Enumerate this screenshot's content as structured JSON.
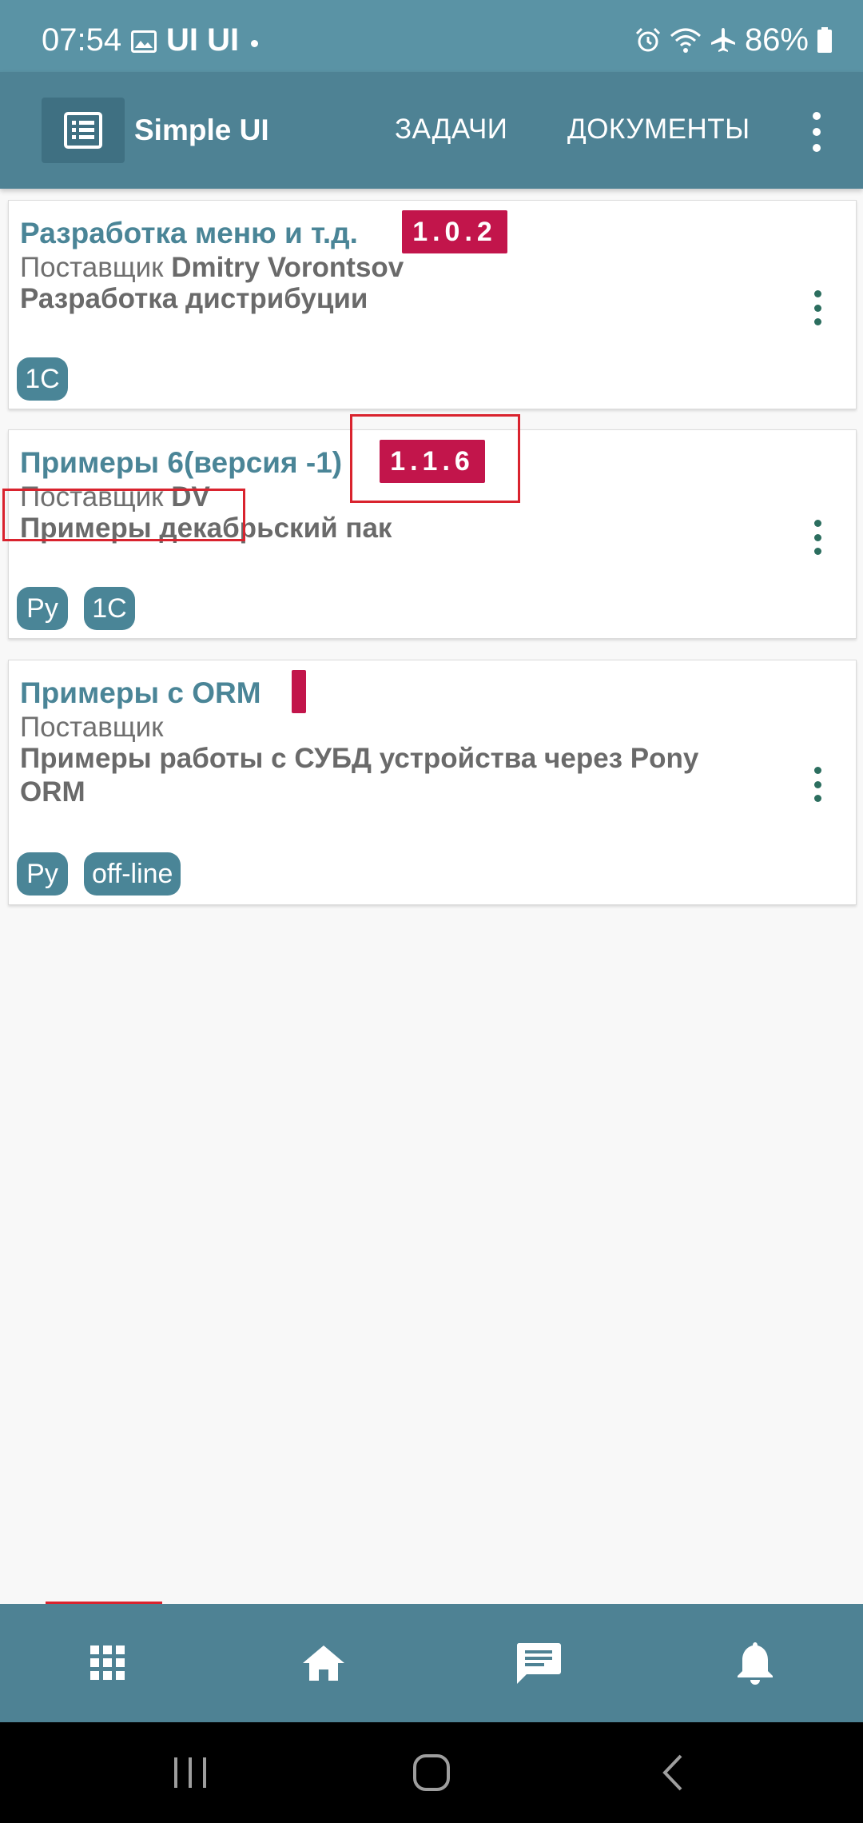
{
  "status_bar": {
    "time": "07:54",
    "notification_icon": "image-icon",
    "notification_apps": "UI UI",
    "battery": "86%"
  },
  "app_bar": {
    "title": "Simple UI",
    "logo_icon": "list-icon",
    "tabs": [
      {
        "label": "ЗАДАЧИ"
      },
      {
        "label": "ДОКУМЕНТЫ"
      }
    ],
    "menu_icon": "more-vertical-icon"
  },
  "cards": [
    {
      "title": "Разработка меню и т.д.",
      "version": "1.0.2",
      "supplier_label": "Поставщик",
      "supplier_name": "Dmitry Vorontsov",
      "description": "Разработка дистрибуции",
      "tags": [
        "1C"
      ]
    },
    {
      "title": "Примеры 6(версия -1)",
      "version": "1.1.6",
      "supplier_label": "Поставщик",
      "supplier_name": "DV",
      "description": "Примеры декабрьский пак",
      "tags": [
        "Py",
        "1C"
      ]
    },
    {
      "title": "Примеры с ORM",
      "version": "",
      "supplier_label": "Поставщик",
      "supplier_name": "",
      "description": "Примеры работы с СУБД устройства через Pony ORM",
      "tags": [
        "Py",
        "off-line"
      ]
    }
  ],
  "bottom_nav": {
    "items": [
      {
        "icon": "apps-grid-icon"
      },
      {
        "icon": "home-icon"
      },
      {
        "icon": "chat-icon"
      },
      {
        "icon": "bell-icon"
      }
    ]
  },
  "colors": {
    "primary": "#4e8294",
    "status_bar": "#5a93a5",
    "accent_badge": "#c2154b",
    "title_text": "#4a8597",
    "highlight": "#d9232e"
  }
}
